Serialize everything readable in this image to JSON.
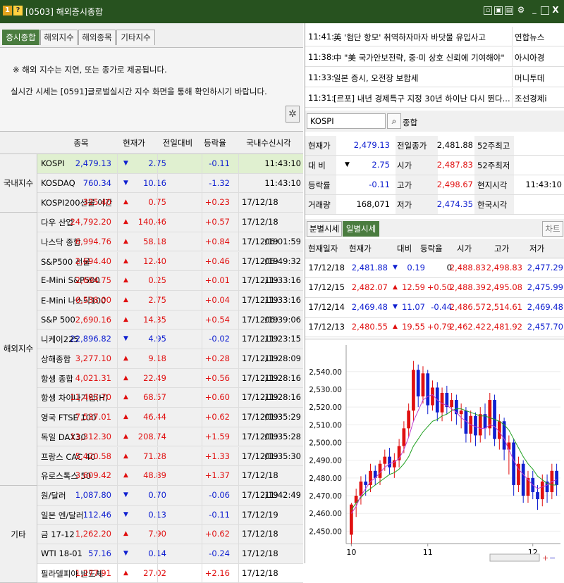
{
  "window": {
    "badge1": "1",
    "badge2": "?",
    "title": "[0503] 해외증시종합",
    "icons": [
      "dock-icon",
      "copy-icon",
      "print-icon",
      "settings-icon",
      "minimize-icon",
      "maximize-icon",
      "close-icon"
    ],
    "close_glyph": "X"
  },
  "tabs": [
    {
      "label": "증시종합",
      "active": true
    },
    {
      "label": "해외지수",
      "active": false
    },
    {
      "label": "해외종목",
      "active": false
    },
    {
      "label": "기타지수",
      "active": false
    }
  ],
  "notice": {
    "line1": "※ 해외 지수는 지연, 또는 종가로 제공됩니다.",
    "line2": "실시간 시세는 [0591]글로벌실시간 지수 화면을 통해 확인하시기 바랍니다."
  },
  "table": {
    "headers": [
      "종목",
      "현재가",
      "전일대비",
      "등락율",
      "국내수신시각"
    ],
    "groups": [
      {
        "label": "국내지수"
      },
      {
        "label": "해외지수"
      },
      {
        "label": "기타"
      }
    ],
    "rows": [
      {
        "name": "KOSPI",
        "price": "2,479.13",
        "dir": "down",
        "change": "2.75",
        "pct": "-0.11",
        "date": "",
        "time": "11:43:10"
      },
      {
        "name": "KOSDAQ",
        "price": "760.34",
        "dir": "down",
        "change": "10.16",
        "pct": "-1.32",
        "date": "",
        "time": "11:43:10"
      },
      {
        "name": "KOSPI200선물 야간",
        "price": "325.40",
        "dir": "up",
        "change": "0.75",
        "pct": "+0.23",
        "date": "17/12/18",
        "time": ""
      },
      {
        "name": "다우 산업",
        "price": "24,792.20",
        "dir": "up",
        "change": "140.46",
        "pct": "+0.57",
        "date": "17/12/18",
        "time": ""
      },
      {
        "name": "나스닥 종합",
        "price": "6,994.76",
        "dir": "up",
        "change": "58.18",
        "pct": "+0.84",
        "date": "17/12/19",
        "time": "06:01:59"
      },
      {
        "name": "S&P500 선물",
        "price": "2,694.40",
        "dir": "up",
        "change": "12.40",
        "pct": "+0.46",
        "date": "17/12/19",
        "time": "06:49:32"
      },
      {
        "name": "E-Mini S&P500",
        "price": "2,694.75",
        "dir": "up",
        "change": "0.25",
        "pct": "+0.01",
        "date": "17/12/19",
        "time": "11:33:16"
      },
      {
        "name": "E-Mini 나스닥100",
        "price": "6,538.00",
        "dir": "up",
        "change": "2.75",
        "pct": "+0.04",
        "date": "17/12/19",
        "time": "11:33:16"
      },
      {
        "name": "S&P 500",
        "price": "2,690.16",
        "dir": "up",
        "change": "14.35",
        "pct": "+0.54",
        "date": "17/12/19",
        "time": "06:39:06"
      },
      {
        "name": "니케이225",
        "price": "22,896.82",
        "dir": "down",
        "change": "4.95",
        "pct": "-0.02",
        "date": "17/12/19",
        "time": "11:23:15"
      },
      {
        "name": "상해종합",
        "price": "3,277.10",
        "dir": "up",
        "change": "9.18",
        "pct": "+0.28",
        "date": "17/12/19",
        "time": "11:28:09"
      },
      {
        "name": "항셍 종합",
        "price": "4,021.31",
        "dir": "up",
        "change": "22.49",
        "pct": "+0.56",
        "date": "17/12/19",
        "time": "11:28:16"
      },
      {
        "name": "항셍 차이나기업(H)",
        "price": "11,483.70",
        "dir": "up",
        "change": "68.57",
        "pct": "+0.60",
        "date": "17/12/19",
        "time": "11:28:16"
      },
      {
        "name": "영국 FTSE 100",
        "price": "7,537.01",
        "dir": "up",
        "change": "46.44",
        "pct": "+0.62",
        "date": "17/12/19",
        "time": "01:35:29"
      },
      {
        "name": "독일 DAX30",
        "price": "13,312.30",
        "dir": "up",
        "change": "208.74",
        "pct": "+1.59",
        "date": "17/12/19",
        "time": "01:35:28"
      },
      {
        "name": "프랑스 CAC 40",
        "price": "5,420.58",
        "dir": "up",
        "change": "71.28",
        "pct": "+1.33",
        "date": "17/12/19",
        "time": "01:35:30"
      },
      {
        "name": "유로스톡스 50",
        "price": "3,609.42",
        "dir": "up",
        "change": "48.89",
        "pct": "+1.37",
        "date": "17/12/18",
        "time": ""
      },
      {
        "name": "원/달러",
        "price": "1,087.80",
        "dir": "down",
        "change": "0.70",
        "pct": "-0.06",
        "date": "17/12/19",
        "time": "11:42:49"
      },
      {
        "name": "일본 엔/달러",
        "price": "112.46",
        "dir": "down",
        "change": "0.13",
        "pct": "-0.11",
        "date": "17/12/19",
        "time": ""
      },
      {
        "name": "금 17-12",
        "price": "1,262.20",
        "dir": "up",
        "change": "7.90",
        "pct": "+0.62",
        "date": "17/12/18",
        "time": ""
      },
      {
        "name": "WTI 18-01",
        "price": "57.16",
        "dir": "down",
        "change": "0.14",
        "pct": "-0.24",
        "date": "17/12/18",
        "time": ""
      },
      {
        "name": "필라델피아 반도체",
        "price": "1,277.91",
        "dir": "up",
        "change": "27.02",
        "pct": "+2.16",
        "date": "17/12/18",
        "time": ""
      }
    ]
  },
  "news": [
    {
      "time": "11:41",
      "headline": "英 '험단 항모' 취역하자마자 바닷물 유입사고",
      "source": "연합뉴스"
    },
    {
      "time": "11:38",
      "headline": "中 \"美 국가안보전략, 중·미 상호 신뢰에 기여해야\"",
      "source": "아시아경"
    },
    {
      "time": "11:33",
      "headline": "일본 증시, 오전장 보합세",
      "source": "머니투데"
    },
    {
      "time": "11:31",
      "headline": "[르포] 내년 경제특구 지정 30년 하이난 다시 뛴다...",
      "source": "조선경제i"
    }
  ],
  "search": {
    "value": "KOSPI",
    "name": "종합",
    "icon": "search-icon"
  },
  "quote": {
    "rows": [
      {
        "l1": "현재가",
        "dir": "",
        "v1": "2,479.13",
        "c1": "blue",
        "l2": "전일종가",
        "v2": "2,481.88",
        "c2": "black",
        "l3": "52주최고",
        "v3": ""
      },
      {
        "l1": "대 비",
        "dir": "down",
        "v1": "2.75",
        "c1": "blue",
        "l2": "시가",
        "v2": "2,487.83",
        "c2": "red",
        "l3": "52주최저",
        "v3": ""
      },
      {
        "l1": "등락률",
        "dir": "",
        "v1": "-0.11",
        "c1": "blue",
        "l2": "고가",
        "v2": "2,498.67",
        "c2": "red",
        "l3": "현지시각",
        "v3": "11:43:10"
      },
      {
        "l1": "거래량",
        "dir": "",
        "v1": "168,071",
        "c1": "black",
        "l2": "저가",
        "v2": "2,474.35",
        "c2": "blue",
        "l3": "한국시각",
        "v3": ""
      }
    ]
  },
  "daily": {
    "tabs": [
      {
        "label": "분별시세",
        "active": false
      },
      {
        "label": "일별시세",
        "active": true
      }
    ],
    "chart_button": "차트",
    "headers": [
      "현재일자",
      "현재가",
      "대비",
      "등락율",
      "시가",
      "고가",
      "저가"
    ],
    "rows": [
      {
        "date": "17/12/18",
        "price": "2,481.88",
        "pc": "blue",
        "dir": "down",
        "change": "0.19",
        "pct": "0",
        "open": "2,488.83",
        "oc": "red",
        "high": "2,498.83",
        "hc": "red",
        "low": "2,477.29",
        "lc": "blue"
      },
      {
        "date": "17/12/15",
        "price": "2,482.07",
        "pc": "red",
        "dir": "up",
        "change": "12.59",
        "pct": "+0.50",
        "open": "2,488.39",
        "oc": "red",
        "high": "2,495.08",
        "hc": "red",
        "low": "2,475.99",
        "lc": "blue"
      },
      {
        "date": "17/12/14",
        "price": "2,469.48",
        "pc": "blue",
        "dir": "down",
        "change": "11.07",
        "pct": "-0.44",
        "open": "2,486.57",
        "oc": "red",
        "high": "2,514.61",
        "hc": "red",
        "low": "2,469.48",
        "lc": "blue"
      },
      {
        "date": "17/12/13",
        "price": "2,480.55",
        "pc": "red",
        "dir": "up",
        "change": "19.55",
        "pct": "+0.79",
        "open": "2,462.42",
        "oc": "red",
        "high": "2,481.92",
        "hc": "red",
        "low": "2,457.70",
        "lc": "blue"
      }
    ]
  },
  "chart_data": {
    "type": "candlestick",
    "y_ticks": [
      "2,450.00",
      "2,460.00",
      "2,470.00",
      "2,480.00",
      "2,490.00",
      "2,500.00",
      "2,510.00",
      "2,520.00",
      "2,530.00",
      "2,540.00"
    ],
    "ylim": [
      2443,
      2555
    ],
    "x_ticks": [
      "10",
      "11",
      "12"
    ],
    "candles": [
      [
        2448,
        2465,
        2442,
        2466
      ],
      [
        2466,
        2470,
        2458,
        2474
      ],
      [
        2470,
        2478,
        2465,
        2481
      ],
      [
        2478,
        2476,
        2470,
        2482
      ],
      [
        2476,
        2484,
        2472,
        2488
      ],
      [
        2484,
        2480,
        2476,
        2487
      ],
      [
        2480,
        2488,
        2476,
        2490
      ],
      [
        2488,
        2492,
        2484,
        2496
      ],
      [
        2492,
        2486,
        2482,
        2497
      ],
      [
        2486,
        2490,
        2480,
        2494
      ],
      [
        2490,
        2498,
        2486,
        2502
      ],
      [
        2498,
        2508,
        2494,
        2512
      ],
      [
        2508,
        2518,
        2503,
        2522
      ],
      [
        2518,
        2541,
        2512,
        2546
      ],
      [
        2541,
        2526,
        2520,
        2544
      ],
      [
        2526,
        2539,
        2522,
        2543
      ],
      [
        2539,
        2521,
        2516,
        2541
      ],
      [
        2521,
        2531,
        2518,
        2535
      ],
      [
        2531,
        2517,
        2512,
        2534
      ],
      [
        2517,
        2528,
        2512,
        2531
      ],
      [
        2528,
        2520,
        2516,
        2532
      ],
      [
        2520,
        2524,
        2512,
        2528
      ],
      [
        2524,
        2516,
        2510,
        2527
      ],
      [
        2516,
        2518,
        2508,
        2522
      ],
      [
        2518,
        2505,
        2500,
        2520
      ],
      [
        2505,
        2515,
        2500,
        2518
      ],
      [
        2515,
        2504,
        2498,
        2517
      ],
      [
        2504,
        2516,
        2500,
        2520
      ],
      [
        2516,
        2508,
        2502,
        2522
      ],
      [
        2508,
        2524,
        2504,
        2528
      ],
      [
        2524,
        2502,
        2498,
        2527
      ],
      [
        2502,
        2512,
        2496,
        2516
      ],
      [
        2512,
        2496,
        2490,
        2514
      ],
      [
        2496,
        2500,
        2482,
        2504
      ],
      [
        2500,
        2476,
        2470,
        2502
      ],
      [
        2476,
        2488,
        2472,
        2492
      ],
      [
        2488,
        2470,
        2466,
        2490
      ],
      [
        2470,
        2480,
        2466,
        2484
      ],
      [
        2480,
        2472,
        2468,
        2484
      ],
      [
        2472,
        2468,
        2462,
        2476
      ],
      [
        2468,
        2478,
        2464,
        2482
      ],
      [
        2478,
        2472,
        2466,
        2482
      ],
      [
        2472,
        2484,
        2468,
        2488
      ],
      [
        2484,
        2476,
        2470,
        2488
      ]
    ],
    "ma_green": [
      2462,
      2466,
      2469,
      2472,
      2474,
      2476,
      2478,
      2480,
      2482,
      2483,
      2485,
      2488,
      2492,
      2498,
      2502,
      2506,
      2509,
      2512,
      2513,
      2515,
      2516,
      2518,
      2519,
      2519,
      2518,
      2517,
      2516,
      2515,
      2515,
      2514,
      2513,
      2512,
      2510,
      2507,
      2502,
      2497,
      2492,
      2488,
      2485,
      2481,
      2479,
      2477,
      2476,
      2476
    ],
    "ma_purple": [
      2460,
      2464,
      2470,
      2474,
      2478,
      2480,
      2483,
      2486,
      2488,
      2489,
      2491,
      2496,
      2503,
      2512,
      2518,
      2524,
      2526,
      2527,
      2524,
      2522,
      2521,
      2519,
      2517,
      2514,
      2512,
      2510,
      2509,
      2508,
      2508,
      2510,
      2509,
      2506,
      2502,
      2496,
      2490,
      2485,
      2482,
      2479,
      2476,
      2474,
      2475,
      2476,
      2478,
      2479
    ]
  }
}
